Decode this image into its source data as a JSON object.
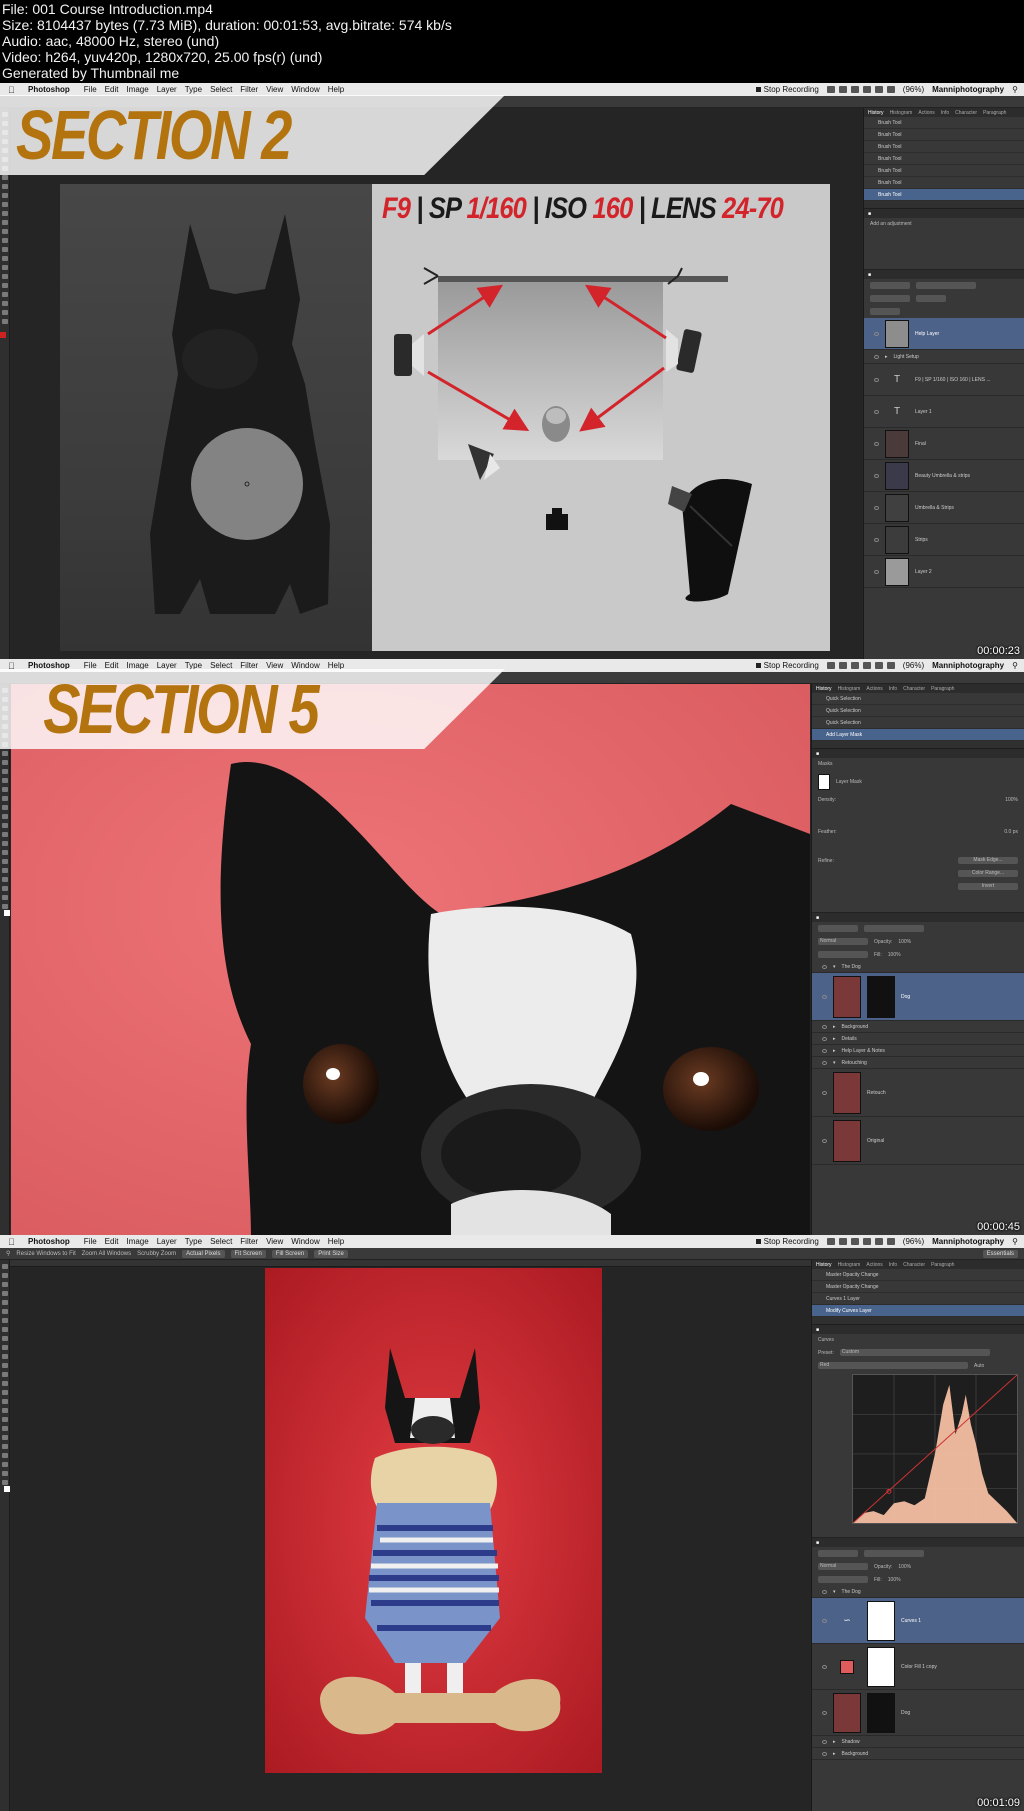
{
  "file_info": {
    "file": "File: 001 Course Introduction.mp4",
    "size": "Size: 8104437 bytes (7.73 MiB), duration: 00:01:53, avg.bitrate: 574 kb/s",
    "audio": "Audio: aac, 48000 Hz, stereo (und)",
    "video": "Video: h264, yuv420p, 1280x720, 25.00 fps(r) (und)",
    "generated": "Generated by Thumbnail me"
  },
  "menubar": {
    "app": "Photoshop",
    "items": [
      "File",
      "Edit",
      "Image",
      "Layer",
      "Type",
      "Select",
      "Filter",
      "View",
      "Window",
      "Help"
    ],
    "recording": "Stop Recording",
    "battery": "(96%)",
    "user": "Manniphotography"
  },
  "colors": {
    "section_text": "#b3740f",
    "frame2_bg": "#e8686b",
    "frame3_bg": "#d3323a",
    "layer_selected": "#4d6289",
    "arrow": "#d2242a"
  },
  "frames": [
    {
      "section_label": "SECTION 2",
      "timestamp": "00:00:23",
      "settings": {
        "f": "F9",
        "sp_label": "SP",
        "sp_value": "1/160",
        "iso_label": "ISO",
        "iso_value": "160",
        "lens_label": "LENS",
        "lens_value": "24-70"
      },
      "history_tabs": [
        "History",
        "Histogram",
        "Actions",
        "Info",
        "Character",
        "Paragraph"
      ],
      "history": [
        "Brush Tool",
        "Brush Tool",
        "Brush Tool",
        "Brush Tool",
        "Brush Tool",
        "Brush Tool",
        "Brush Tool"
      ],
      "adjustments_label": "Add an adjustment",
      "layers": [
        "Help Layer",
        "Light Setup",
        "F9 | SP 1/160 | ISO 160 | LENS ...",
        "Layer 1",
        "Final",
        "Beauty Umbrella & strips",
        "Umbrella & Strips",
        "Strips",
        "Layer 2"
      ]
    },
    {
      "section_label": "SECTION 5",
      "timestamp": "00:00:45",
      "history_tabs": [
        "History",
        "Histogram",
        "Actions",
        "Info",
        "Character",
        "Paragraph"
      ],
      "history": [
        "Quick Selection",
        "Quick Selection",
        "Quick Selection",
        "Add Layer Mask"
      ],
      "properties_title": "Masks",
      "mask_label": "Layer Mask",
      "density_label": "Density:",
      "density_value": "100%",
      "feather_label": "Feather:",
      "feather_value": "0.0 px",
      "refine_label": "Refine:",
      "mask_edge": "Mask Edge...",
      "color_range": "Color Range...",
      "invert": "Invert",
      "blend_mode": "Normal",
      "opacity_label": "Opacity:",
      "opacity_value": "100%",
      "fill_label": "Fill:",
      "fill_value": "100%",
      "layers": [
        {
          "name": "The Dog",
          "kind": "group"
        },
        {
          "name": "Dog",
          "kind": "layer-mask",
          "selected": true
        },
        {
          "name": "Background",
          "kind": "group"
        },
        {
          "name": "Details",
          "kind": "group"
        },
        {
          "name": "Help Layer & Notes",
          "kind": "group"
        },
        {
          "name": "Retouching",
          "kind": "group"
        },
        {
          "name": "Retouch",
          "kind": "layer"
        },
        {
          "name": "Original",
          "kind": "layer"
        }
      ]
    },
    {
      "timestamp": "00:01:09",
      "options": [
        "Resize Windows to Fit",
        "Zoom All Windows",
        "Scrubby Zoom"
      ],
      "option_buttons": [
        "Actual Pixels",
        "Fit Screen",
        "Fill Screen",
        "Print Size"
      ],
      "workspace": "Essentials",
      "history_tabs": [
        "History",
        "Histogram",
        "Actions",
        "Info",
        "Character",
        "Paragraph"
      ],
      "history": [
        "Master Opacity Change",
        "Master Opacity Change",
        "Curves 1 Layer",
        "Modify Curves Layer"
      ],
      "properties_title": "Curves",
      "preset_label": "Preset:",
      "preset_value": "Custom",
      "channel_value": "Red",
      "auto_label": "Auto",
      "blend_mode": "Normal",
      "opacity_label": "Opacity:",
      "opacity_value": "100%",
      "fill_label": "Fill:",
      "fill_value": "100%",
      "layers": [
        {
          "name": "The Dog",
          "kind": "group"
        },
        {
          "name": "Curves 1",
          "kind": "adjustment",
          "selected": true
        },
        {
          "name": "Color Fill 1 copy",
          "kind": "fill"
        },
        {
          "name": "Dog",
          "kind": "layer-mask"
        },
        {
          "name": "Shadow",
          "kind": "group"
        },
        {
          "name": "Background",
          "kind": "group"
        }
      ]
    }
  ]
}
